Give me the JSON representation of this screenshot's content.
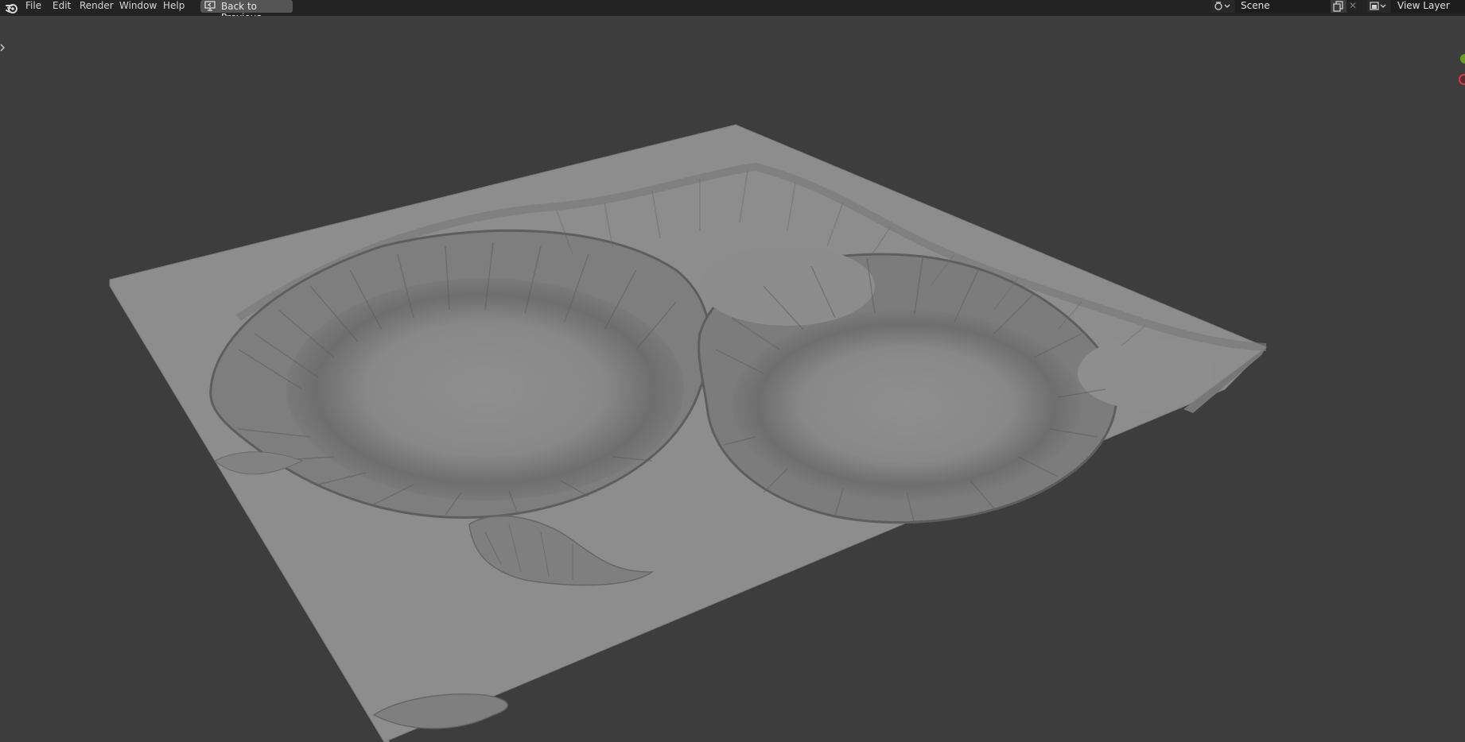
{
  "menu": {
    "file": "File",
    "edit": "Edit",
    "render": "Render",
    "window": "Window",
    "help": "Help"
  },
  "back_button": {
    "label": "Back to Previous"
  },
  "scene": {
    "name": "Scene"
  },
  "view_layer": {
    "name": "View Layer"
  },
  "colors": {
    "topbar": "#232323",
    "viewport": "#3d3d3d",
    "terrain": "#8f8f8f",
    "gizmo_y": "#6a9a2a",
    "gizmo_x": "#c8404e"
  },
  "icons": [
    "blender-logo-icon",
    "back-to-previous-icon",
    "scene-icon",
    "copy-icon",
    "close-icon",
    "view-layer-icon",
    "sidebar-toggle-icon"
  ]
}
